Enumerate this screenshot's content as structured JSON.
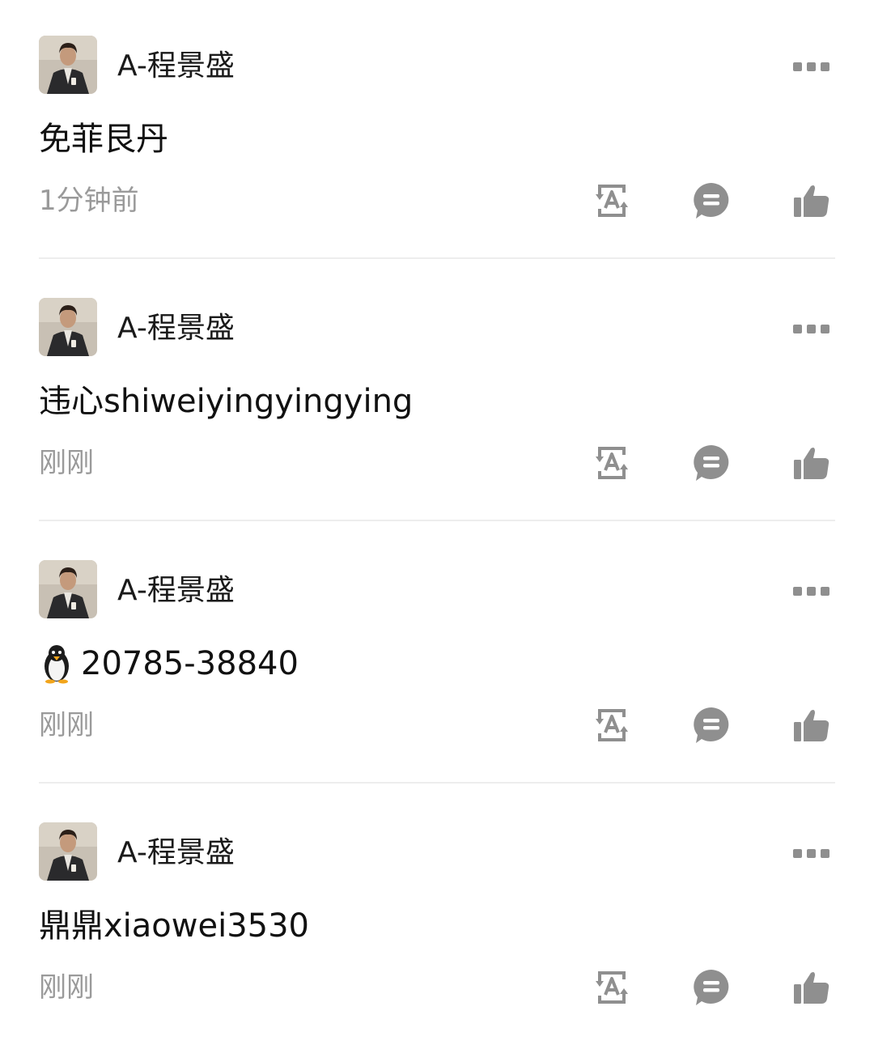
{
  "posts": [
    {
      "username": "A-程景盛",
      "content": "免菲艮丹",
      "time": "1分钟前"
    },
    {
      "username": "A-程景盛",
      "content": "违心shiweiyingyingying",
      "time": "刚刚"
    },
    {
      "username": "A-程景盛",
      "content": "20785-38840",
      "time": "刚刚",
      "content_icon": "penguin-icon"
    },
    {
      "username": "A-程景盛",
      "content": "鼎鼎xiaowei3530",
      "time": "刚刚"
    }
  ],
  "icons": {
    "more": "more-dots-icon",
    "translate": "translate-icon",
    "comment": "comment-icon",
    "like": "thumbs-up-icon"
  },
  "colors": {
    "text": "#111111",
    "secondary": "#9a9a9a",
    "icon": "#8f8f8f",
    "divider": "#ededed"
  }
}
